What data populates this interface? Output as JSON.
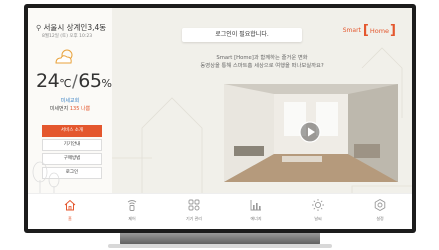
{
  "status": {
    "location": "서울시 상계인3,4동",
    "datetime": "8월12일 (토) 오후 10:23",
    "temperature": "24",
    "temp_unit": "℃",
    "humidity": "65",
    "humidity_unit": "%",
    "air_quality": "미세교회",
    "dust_label": "미세먼지",
    "dust_value": "135 나쁨",
    "weather_icon": "partly-cloudy-icon"
  },
  "menu": {
    "items": [
      {
        "label": "서비스 소개",
        "active": true
      },
      {
        "label": "기기안내",
        "active": false
      },
      {
        "label": "구매방법",
        "active": false
      },
      {
        "label": "로그인",
        "active": false
      }
    ]
  },
  "main": {
    "login_prompt": "로그인이 필요합니다.",
    "brand_prefix": "Smart",
    "brand_name": "Home",
    "promo_line1": "Smart [Home]과 함께하는 즐거운 변화",
    "promo_line2": "동영상을 통해 스마트홈 세상으로 여행을 떠나보실까요?",
    "video_play_icon": "play-icon"
  },
  "nav": {
    "items": [
      {
        "label": "홈",
        "icon": "home-icon",
        "active": true
      },
      {
        "label": "제어",
        "icon": "control-icon",
        "active": false
      },
      {
        "label": "기기 관리",
        "icon": "device-manage-icon",
        "active": false
      },
      {
        "label": "에너지",
        "icon": "energy-chart-icon",
        "active": false
      },
      {
        "label": "날씨",
        "icon": "weather-sun-icon",
        "active": false
      },
      {
        "label": "설정",
        "icon": "settings-icon",
        "active": false
      }
    ]
  },
  "colors": {
    "accent": "#e4572e",
    "panel_bg": "#f1f0ea",
    "frame": "#1c1c1c"
  }
}
